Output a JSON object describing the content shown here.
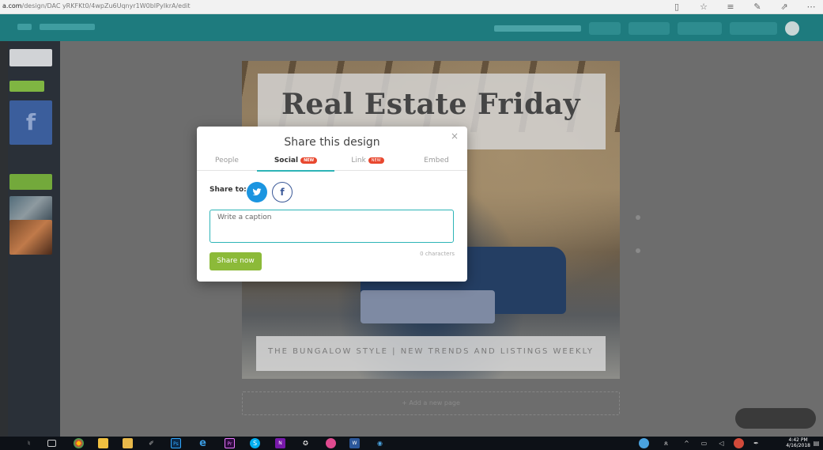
{
  "browser": {
    "url_domain": "a.com",
    "url_path": "/design/DAC yRKFKt0/4wpZu6Uqnyr1W0bIPyIkrA/edit"
  },
  "design": {
    "title": "Real Estate Friday",
    "bottom_text": "THE BUNGALOW STYLE  |  NEW TRENDS AND LISTINGS WEEKLY"
  },
  "add_page_label": "+ Add a new page",
  "modal": {
    "title": "Share this design",
    "close_glyph": "×",
    "tabs": [
      {
        "label": "People",
        "badge": ""
      },
      {
        "label": "Social",
        "badge": "NEW"
      },
      {
        "label": "Link",
        "badge": "NEW"
      },
      {
        "label": "Embed",
        "badge": ""
      }
    ],
    "active_tab": "Social",
    "share_to_label": "Share to:",
    "twitter_glyph": "🐦",
    "facebook_glyph": "f",
    "caption_placeholder": "Write a caption",
    "char_count": "0 characters",
    "share_button": "Share now"
  },
  "taskbar": {
    "time": "4:42 PM",
    "date": "4/16/2018"
  },
  "colors": {
    "app_header": "#1e7b7e",
    "accent_teal": "#2db4b7",
    "share_green": "#8cba39",
    "new_badge": "#e8482f",
    "twitter_blue": "#1b95e0",
    "facebook_blue": "#3b5998"
  }
}
